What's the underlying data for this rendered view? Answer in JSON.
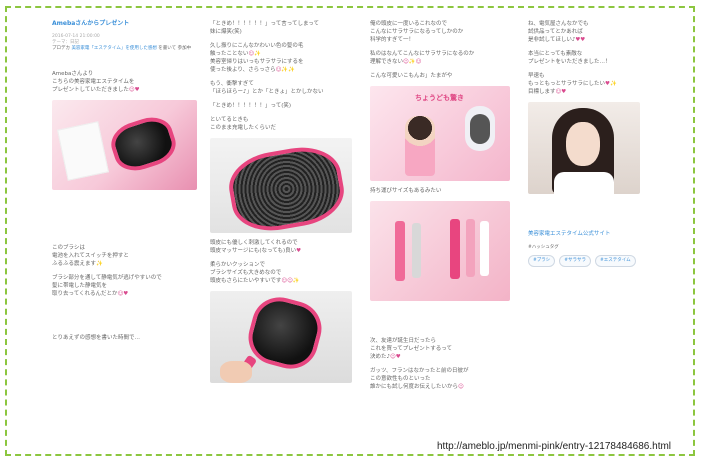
{
  "url": "http://ameblo.jp/menmi-pink/entry-12178484686.html",
  "col1": {
    "title": "Amebaさんからプレゼント",
    "date": "2016-07-14 21:00:00",
    "theme": "テーマ：日記",
    "ref_label": "プロデカ",
    "ref_link": "美容家電「エステタイム」を使用した感想",
    "ref_tail": "を書いて 参加中",
    "lines_a": [
      "Amebaさんより",
      "こちらの美容家電エステタイムを",
      "プレゼントしていただきました"
    ],
    "lines_b": [
      "このブラシは",
      "電池を入れてスイッチを押すと",
      "ふるふる震えます"
    ],
    "lines_c": [
      "ブラシ部分を通して静電気が逃げやすいので",
      "髪に帯電した静電気を",
      "取り去ってくれるんだとか"
    ],
    "lines_d": [
      "とりあえずの感想を書いた時間で…"
    ]
  },
  "col2": {
    "lines_a": [
      "「ときめ！！！！！！」って言ってしまって",
      "妹に爆笑(笑)"
    ],
    "lines_b": [
      "久し振りにこんなかわいい色の髪の毛",
      "触ったことない",
      "美容室帰りはいっもサラサラにするを",
      "使った後より、さらっさら"
    ],
    "lines_c": [
      "もう、衝撃すぎて",
      "「ほらほらー♪」とか「ときょ」とかしかない"
    ],
    "lines_d": [
      "「ときめ！！！！！！」って(笑)"
    ],
    "lines_e": [
      "といてるときも",
      "このまま充電したくらいだ"
    ],
    "lines_f": [
      "頭皮にも優しく刺激してくれるので",
      "頭皮マッサージにも(なっても)良い"
    ],
    "lines_g": [
      "柔らかいクッションで",
      "ブラシサイズも大きめなので",
      "頭皮もさらにたいやすいです"
    ]
  },
  "col3": {
    "lines_a": [
      "俺の頭皮に一度いるこれなので",
      "こんなにサラサラになるってしかのか",
      "科学的すぎて一！"
    ],
    "lines_b": [
      "私のはなんてこんなにサラサラになるのか",
      "理解できない"
    ],
    "lines_c": [
      "こんな可愛いこもんお」たまがや"
    ],
    "box_text": "ちょうども驚き",
    "lines_d": [
      "持ち運びサイズもあるみたい"
    ],
    "lines_e": [
      "次、友達が誕生日だったら",
      "これを買ってプレゼントするって",
      "決めた♪"
    ],
    "lines_f": [
      "ガッツ、フランはなかったと前の日彼が",
      "この意欲性ものといった",
      "誰かにも試し何度お伝えしたいから"
    ]
  },
  "col4": {
    "lines_a": [
      "ね、電気屋さんなかでも",
      "試供品ってとかあれば",
      "是非試してほしい♪"
    ],
    "lines_b": [
      "本当にとっても素敵な",
      "プレゼントをいただきました…！"
    ],
    "lines_c": [
      "早速も",
      "もっともっとサラサラにしたい",
      "目標します"
    ],
    "link": "美容家電エステタイム公式サイト",
    "hashtag_heading": "#ハッシュタグ",
    "tags": [
      "#ブラシ",
      "#サラサラ",
      "#エステタイム"
    ]
  }
}
